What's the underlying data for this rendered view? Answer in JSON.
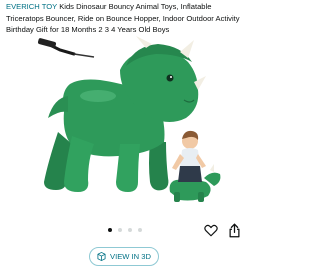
{
  "product": {
    "brand": "EVERICH TOY",
    "title_rest": " Kids Dinosaur Bouncy Animal Toys, Inflatable Triceratops Bouncer, Ride on Bounce Hopper, Indoor Outdoor Activity Birthday Gift for 18 Months 2 3 4 Years Old Boys",
    "image_alt": "Green inflatable triceratops bouncer with hand pump and toddler riding"
  },
  "carousel": {
    "dot_count": 4,
    "active_index": 0
  },
  "actions": {
    "favorite_icon": "heart-icon",
    "share_icon": "share-icon"
  },
  "view_3d": {
    "label": "VIEW IN 3D",
    "icon": "cube-icon"
  },
  "colors": {
    "link": "#007185",
    "toy_green": "#2e9a5a",
    "horn": "#f2eee3"
  }
}
